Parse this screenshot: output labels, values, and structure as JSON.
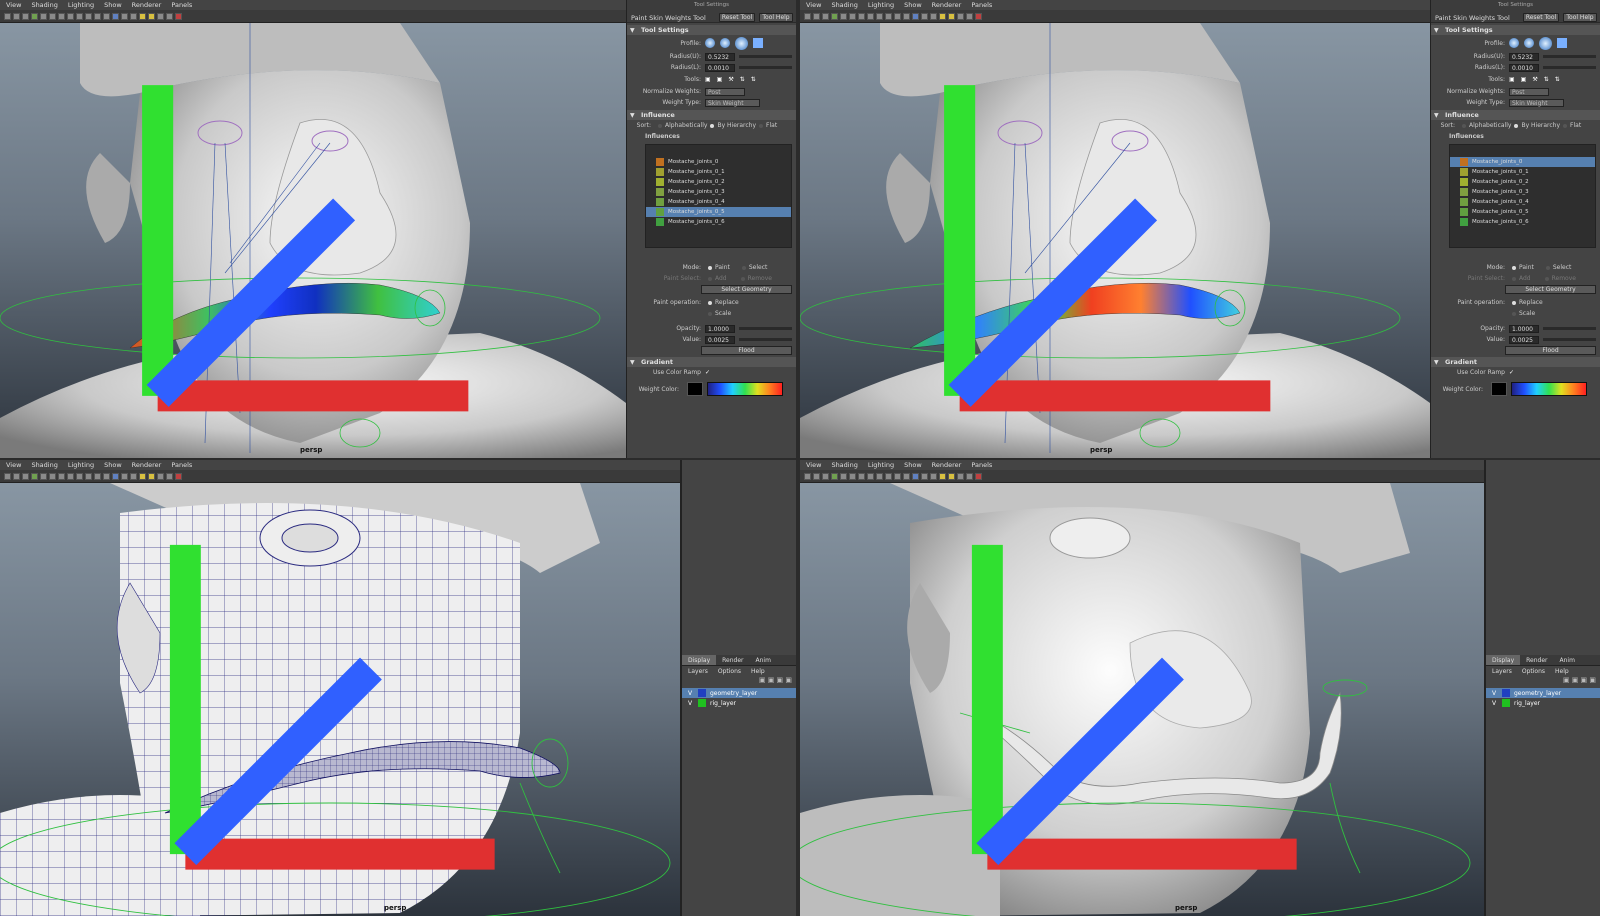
{
  "menu": {
    "view": "View",
    "shading": "Shading",
    "lighting": "Lighting",
    "show": "Show",
    "renderer": "Renderer",
    "panels": "Panels"
  },
  "camera_label": "persp",
  "tool": {
    "header": "Tool Settings",
    "name": "Paint Skin Weights Tool",
    "reset": "Reset Tool",
    "help": "Tool Help",
    "section_tool_settings": "Tool Settings",
    "profile": "Profile:",
    "radius_u": "Radius(U):",
    "radius_u_val": "0.5232",
    "radius_l": "Radius(L):",
    "radius_l_val": "0.0010",
    "tools": "Tools:",
    "normalize": "Normalize Weights:",
    "normalize_val": "Post",
    "weight_type": "Weight Type:",
    "weight_type_val": "Skin Weight",
    "section_influence": "Influence",
    "sort": "Sort:",
    "alpha": "Alphabetically",
    "hier": "By Hierarchy",
    "flat": "Flat",
    "influences": "Influences",
    "joints": [
      "Mostache_joints_0",
      "Mostache_joints_0_1",
      "Mostache_joints_0_2",
      "Mostache_joints_0_3",
      "Mostache_joints_0_4",
      "Mostache_joints_0_5",
      "Mostache_joints_0_6"
    ],
    "joint_colors": [
      "#c07020",
      "#a0a030",
      "#a0b030",
      "#80a040",
      "#70a040",
      "#60a040",
      "#40a040"
    ],
    "mode": "Mode:",
    "paint": "Paint",
    "select": "Select",
    "paint_select": "Paint Select:",
    "add": "Add",
    "remove": "Remove",
    "select_geometry": "Select Geometry",
    "paint_operation": "Paint operation:",
    "replace": "Replace",
    "scale": "Scale",
    "opacity": "Opacity:",
    "opacity_val": "1.0000",
    "value": "Value:",
    "value_val": "0.0025",
    "flood": "Flood",
    "section_gradient": "Gradient",
    "use_color_ramp": "Use Color Ramp",
    "weight_color": "Weight Color:"
  },
  "layers": {
    "tabs": [
      "Display",
      "Render",
      "Anim"
    ],
    "menu": [
      "Layers",
      "Options",
      "Help"
    ],
    "rows": [
      {
        "v": "V",
        "name": "geometry_layer",
        "color": "#2040c0"
      },
      {
        "v": "V",
        "name": "rig_layer",
        "color": "#20c020"
      }
    ]
  }
}
